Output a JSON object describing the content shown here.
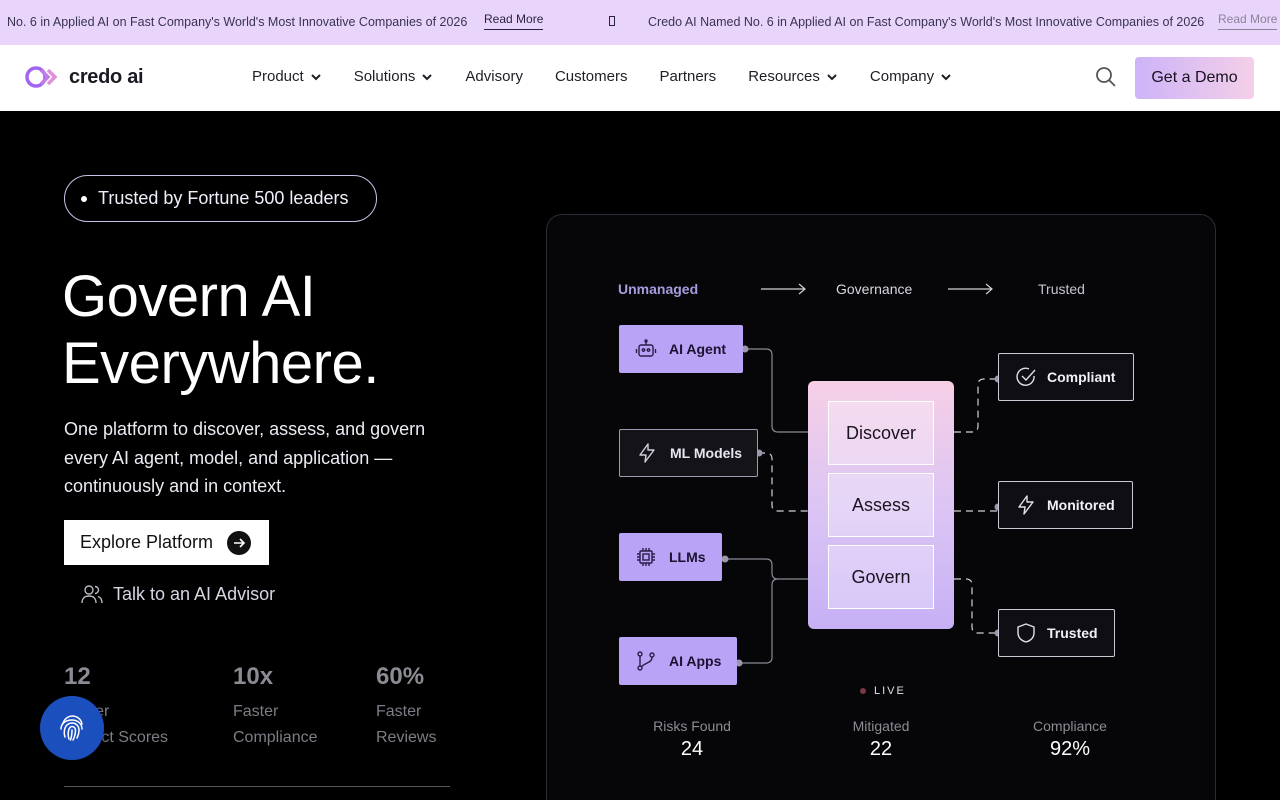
{
  "announcement": {
    "message_1": "No. 6 in Applied AI on Fast Company's World's Most Innovative Companies of 2026",
    "link_1": "Read More",
    "message_2": "Credo AI Named No. 6 in Applied AI on Fast Company's World's Most Innovative Companies of 2026",
    "link_2": "Read More"
  },
  "nav": {
    "logo_text": "credo ai",
    "items": [
      {
        "label": "Product",
        "dropdown": true
      },
      {
        "label": "Solutions",
        "dropdown": true
      },
      {
        "label": "Advisory",
        "dropdown": false
      },
      {
        "label": "Customers",
        "dropdown": false
      },
      {
        "label": "Partners",
        "dropdown": false
      },
      {
        "label": "Resources",
        "dropdown": true
      },
      {
        "label": "Company",
        "dropdown": true
      }
    ],
    "search_icon": "search-icon",
    "cta_label": "Get a Demo"
  },
  "hero": {
    "badge": "Trusted by Fortune 500 leaders",
    "headline_line1": "Govern AI",
    "headline_line2": "Everywhere.",
    "subtitle": "One platform to discover, assess, and govern every AI agent, model, and application — continuously and in context.",
    "primary_cta": "Explore Platform",
    "secondary_cta": "Talk to an AI Advisor",
    "stats": [
      {
        "value": "12",
        "label_line1": "Faster",
        "label_line2": "Project Scores"
      },
      {
        "value": "10x",
        "label_line1": "Faster",
        "label_line2": "Compliance"
      },
      {
        "value": "60%",
        "label_line1": "Faster",
        "label_line2": "Reviews"
      }
    ]
  },
  "diagram": {
    "stages": [
      "Unmanaged",
      "Governance",
      "Trusted"
    ],
    "sources": [
      {
        "label": "AI Agent",
        "icon": "robot-icon"
      },
      {
        "label": "ML Models",
        "icon": "lightning-icon"
      },
      {
        "label": "LLMs",
        "icon": "chip-icon"
      },
      {
        "label": "AI Apps",
        "icon": "branch-icon"
      }
    ],
    "core_steps": [
      "Discover",
      "Assess",
      "Govern"
    ],
    "outcomes": [
      {
        "label": "Compliant",
        "icon": "check-circle-icon"
      },
      {
        "label": "Monitored",
        "icon": "lightning-icon"
      },
      {
        "label": "Trusted",
        "icon": "shield-icon"
      }
    ],
    "live_label": "LIVE",
    "metrics": [
      {
        "label": "Risks Found",
        "value": "24"
      },
      {
        "label": "Mitigated",
        "value": "22"
      },
      {
        "label": "Compliance",
        "value": "92%"
      }
    ]
  },
  "colors": {
    "announce_bg": "#e9d5fb",
    "accent_purple": "#b9a3f7",
    "fab_blue": "#1b4fbd"
  }
}
